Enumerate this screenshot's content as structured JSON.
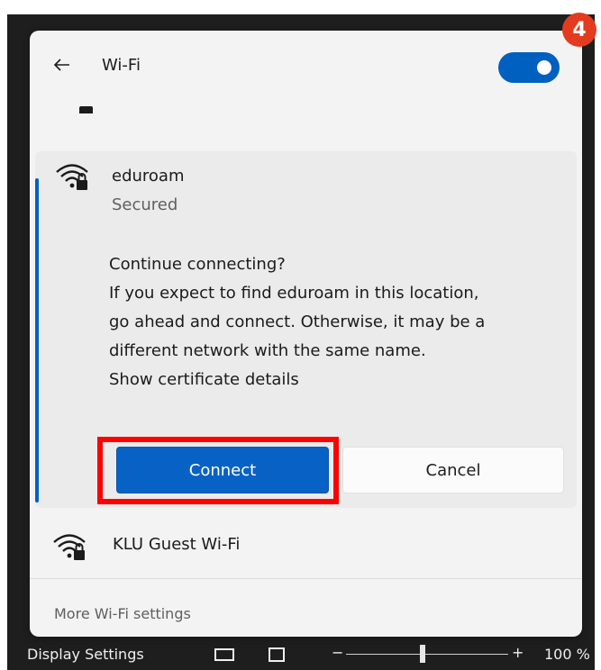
{
  "header": {
    "title": "Wi-Fi",
    "toggle_state": "on"
  },
  "badge": {
    "number": "4",
    "color": "#e23b1f"
  },
  "selected_network": {
    "name": "eduroam",
    "status": "Secured",
    "message_lines": [
      "Continue connecting?",
      "If you expect to find eduroam in this location,",
      "go ahead and connect. Otherwise, it may be a",
      "different network with the same name.",
      "Show certificate details"
    ],
    "connect_label": "Connect",
    "cancel_label": "Cancel"
  },
  "other_network": {
    "name": "KLU Guest Wi-Fi"
  },
  "footer": {
    "more_settings": "More Wi-Fi settings"
  },
  "taskbar": {
    "display_settings": "Display Settings",
    "zoom_minus": "−",
    "zoom_plus": "+",
    "zoom_level": "100 %"
  },
  "colors": {
    "accent": "#0060c0",
    "highlight": "#ff0000"
  },
  "icons": {
    "back": "back-arrow-icon",
    "wifi_secured": "wifi-lock-icon",
    "display_settings": "display-settings-icon"
  }
}
